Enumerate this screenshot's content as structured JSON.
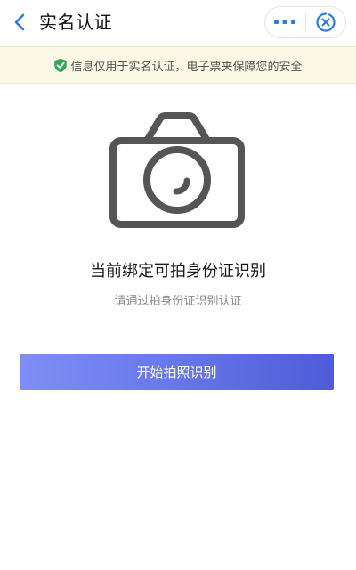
{
  "header": {
    "title": "实名认证",
    "back_icon": "chevron-left-icon",
    "more_icon": "more-dots-icon",
    "close_icon": "close-circle-icon",
    "accent_color": "#2b7be0"
  },
  "notice": {
    "icon": "shield-check-icon",
    "text": "信息仅用于实名认证，电子票夹保障您的安全",
    "icon_color": "#3aa655",
    "background": "#fbf8e6"
  },
  "main": {
    "illustration_icon": "camera-icon",
    "headline": "当前绑定可拍身份证识别",
    "subline": "请通过拍身份证识别认证",
    "start_button_label": "开始拍照识别",
    "button_gradient": [
      "#7f8ef5",
      "#4e5cd8"
    ]
  }
}
